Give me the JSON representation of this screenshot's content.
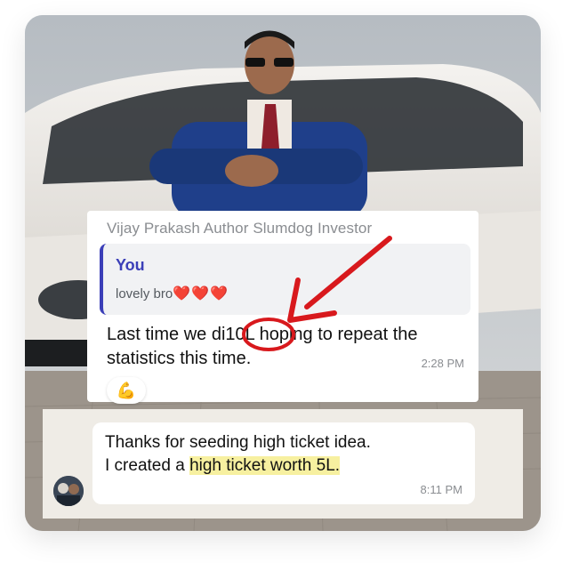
{
  "reply_card": {
    "sender": "Vijay Prakash Author Slumdog Investor",
    "quoted": {
      "author": "You",
      "text": "lovely bro",
      "hearts": "❤️❤️❤️"
    },
    "message": "Last time we did 10L hoping to repeat the statistics this time.",
    "message_parts": {
      "before": "Last time we di",
      "circled": "10L",
      "after": " hoping to repeat the statistics this time."
    },
    "time": "2:28 PM",
    "reaction": "💪"
  },
  "chat": {
    "message_line1": "Thanks for seeding high ticket idea.",
    "message_line2_prefix": "I created a ",
    "message_highlight": "high ticket worth 5L.",
    "time": "8:11 PM"
  },
  "colors": {
    "annotation_red": "#d8191d",
    "highlight_yellow": "#f7f0a0",
    "quote_accent": "#3b3fb8"
  }
}
